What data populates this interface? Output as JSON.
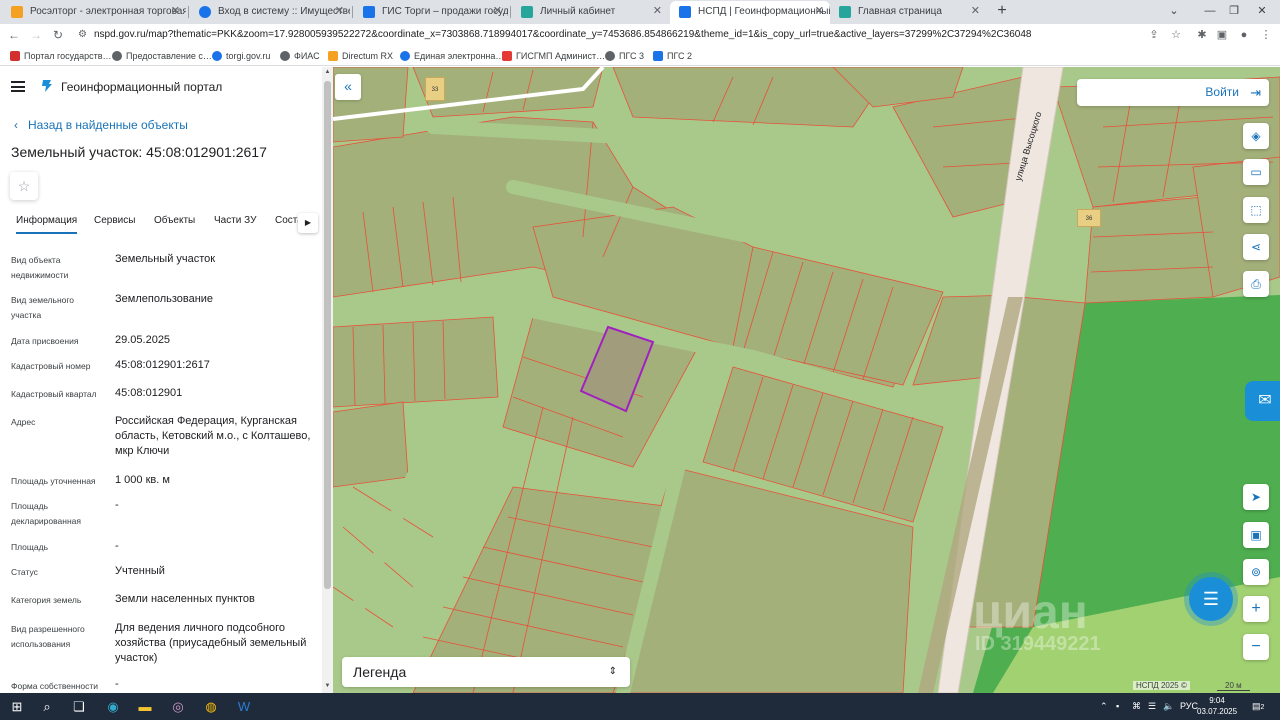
{
  "browser": {
    "tabs": [
      {
        "label": "Росэлторг - электронная торговая",
        "active": false,
        "favicon_color": "#f4a020"
      },
      {
        "label": "Вход в систему :: Имущественн",
        "active": false,
        "favicon_color": "#1a73e8"
      },
      {
        "label": "ГИС Торги – продажи государс",
        "active": false,
        "favicon_color": "#1a73e8"
      },
      {
        "label": "Личный кабинет",
        "active": false,
        "favicon_color": "#26a69a"
      },
      {
        "label": "НСПД | Геоинформационный п",
        "active": true,
        "favicon_color": "#1a73e8"
      },
      {
        "label": "Главная страница",
        "active": false,
        "favicon_color": "#26a69a"
      }
    ],
    "new_tab_label": "+",
    "url": "nspd.gov.ru/map?thematic=PKK&zoom=17.928005939522272&coordinate_x=7303868.718994017&coordinate_y=7453686.854866219&theme_id=1&is_copy_url=true&active_layers=37299%2C37294%2C36048",
    "bookmarks": [
      {
        "label": "Портал государств…",
        "color": "#d32f2f"
      },
      {
        "label": "Предоставление с…",
        "color": "#5f6368"
      },
      {
        "label": "torgi.gov.ru",
        "color": "#1a73e8"
      },
      {
        "label": "ФИАС",
        "color": "#5f6368"
      },
      {
        "label": "Directum RX",
        "color": "#f4a020"
      },
      {
        "label": "Единая электронна…",
        "color": "#1a73e8"
      },
      {
        "label": "ГИСГМП Админист…",
        "color": "#e53935"
      },
      {
        "label": "ПГС 3",
        "color": "#5f6368"
      },
      {
        "label": "ПГС 2",
        "color": "#1a73e8"
      }
    ]
  },
  "panel": {
    "portal_title": "Геоинформационный портал",
    "back_label": "Назад в найденные объекты",
    "parcel_title": "Земельный участок: 45:08:012901:2617",
    "tabs": [
      "Информация",
      "Сервисы",
      "Объекты",
      "Части ЗУ",
      "Соста"
    ],
    "properties": [
      {
        "label": "Вид объекта недвижимости",
        "value": "Земельный участок"
      },
      {
        "label": "Вид земельного участка",
        "value": "Землепользование"
      },
      {
        "label": "Дата присвоения",
        "value": "29.05.2025"
      },
      {
        "label": "Кадастровый номер",
        "value": "45:08:012901:2617"
      },
      {
        "label": "Кадастровый квартал",
        "value": "45:08:012901"
      },
      {
        "label": "Адрес",
        "value": "Российская Федерация, Курганская область, Кетовский м.о., с Колташево, мкр Ключи"
      },
      {
        "label": "Площадь уточненная",
        "value": "1 000 кв. м"
      },
      {
        "label": "Площадь декларированная",
        "value": "-"
      },
      {
        "label": "Площадь",
        "value": "-"
      },
      {
        "label": "Статус",
        "value": "Учтенный"
      },
      {
        "label": "Категория земель",
        "value": "Земли населенных пунктов"
      },
      {
        "label": "Вид разрешенного использования",
        "value": "Для ведения личного подсобного хозяйства (приусадебный земельный участок)"
      },
      {
        "label": "Форма собственности",
        "value": "-"
      }
    ]
  },
  "map": {
    "login_label": "Войти",
    "legend_label": "Легенда",
    "street_label": "улица Высоцкого",
    "house_numbers": [
      "33",
      "36"
    ],
    "watermark": "циан",
    "watermark_id": "ID 319449221",
    "copyright": "НСПД 2025 ©",
    "scale_label": "20 м",
    "colors": {
      "land": "#a9c98a",
      "parcel_fill": "#a3b07a",
      "parcel_border": "#e8503a",
      "selected_border": "#a020c0",
      "forest": "#4fae4f",
      "road": "#f0e6e0"
    }
  },
  "taskbar": {
    "language": "РУС",
    "time": "9:04",
    "date": "03.07.2025",
    "notifications": "2"
  }
}
